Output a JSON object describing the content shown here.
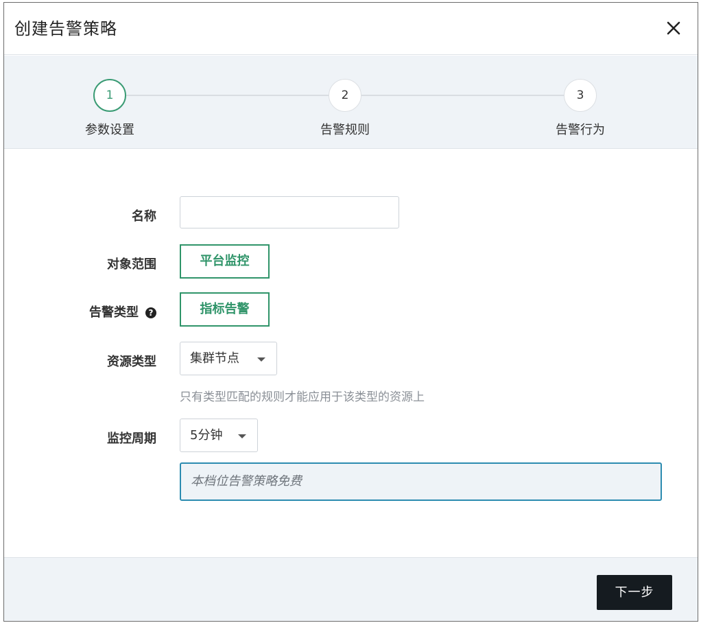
{
  "dialog": {
    "title": "创建告警策略"
  },
  "steps": [
    {
      "number": "1",
      "label": "参数设置",
      "active": true
    },
    {
      "number": "2",
      "label": "告警规则",
      "active": false
    },
    {
      "number": "3",
      "label": "告警行为",
      "active": false
    }
  ],
  "form": {
    "name": {
      "label": "名称",
      "value": "",
      "placeholder": ""
    },
    "scope": {
      "label": "对象范围",
      "value": "平台监控"
    },
    "alert_type": {
      "label": "告警类型",
      "value": "指标告警",
      "help_icon": "question-circle-icon"
    },
    "resource_type": {
      "label": "资源类型",
      "value": "集群节点",
      "hint": "只有类型匹配的规则才能应用于该类型的资源上"
    },
    "monitor_period": {
      "label": "监控周期",
      "value": "5分钟"
    },
    "notice": "本档位告警策略免费"
  },
  "footer": {
    "next_label": "下一步"
  },
  "colors": {
    "accent_green": "#2f9469",
    "notice_border": "#2b8bb0",
    "primary_button": "#151b20"
  }
}
